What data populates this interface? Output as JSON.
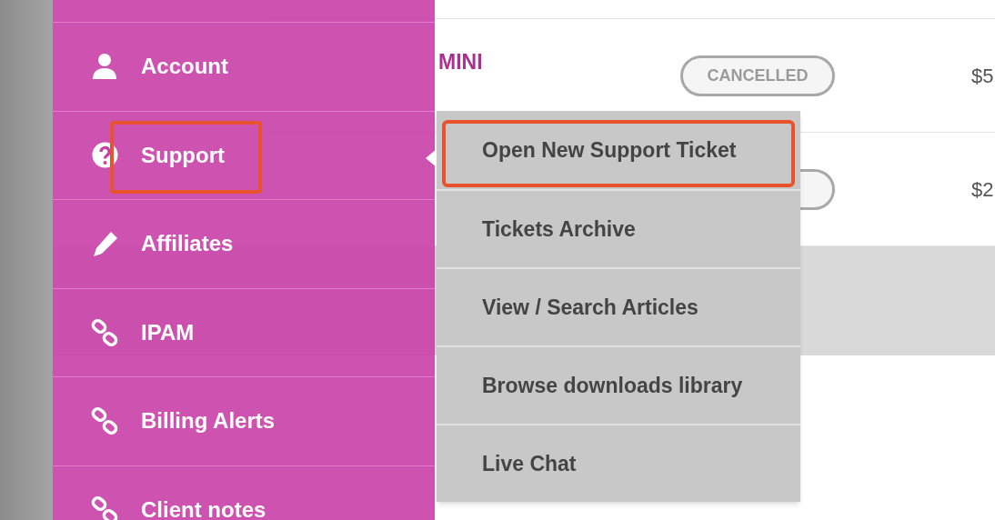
{
  "products": [
    {
      "name": "MINI",
      "status": "CANCELLED",
      "price": "$5"
    },
    {
      "price": "$2"
    }
  ],
  "sidebar": {
    "items": [
      {
        "label": "Account",
        "highlighted": false
      },
      {
        "label": "Support",
        "highlighted": true
      },
      {
        "label": "Affiliates",
        "highlighted": false
      },
      {
        "label": "IPAM",
        "highlighted": false
      },
      {
        "label": "Billing Alerts",
        "highlighted": false
      },
      {
        "label": "Client notes",
        "highlighted": false
      }
    ]
  },
  "submenu": {
    "items": [
      {
        "label": "Open New Support Ticket",
        "highlighted": true
      },
      {
        "label": "Tickets Archive",
        "highlighted": false
      },
      {
        "label": "View / Search Articles",
        "highlighted": false
      },
      {
        "label": "Browse downloads library",
        "highlighted": false
      },
      {
        "label": "Live Chat",
        "highlighted": false
      }
    ]
  }
}
